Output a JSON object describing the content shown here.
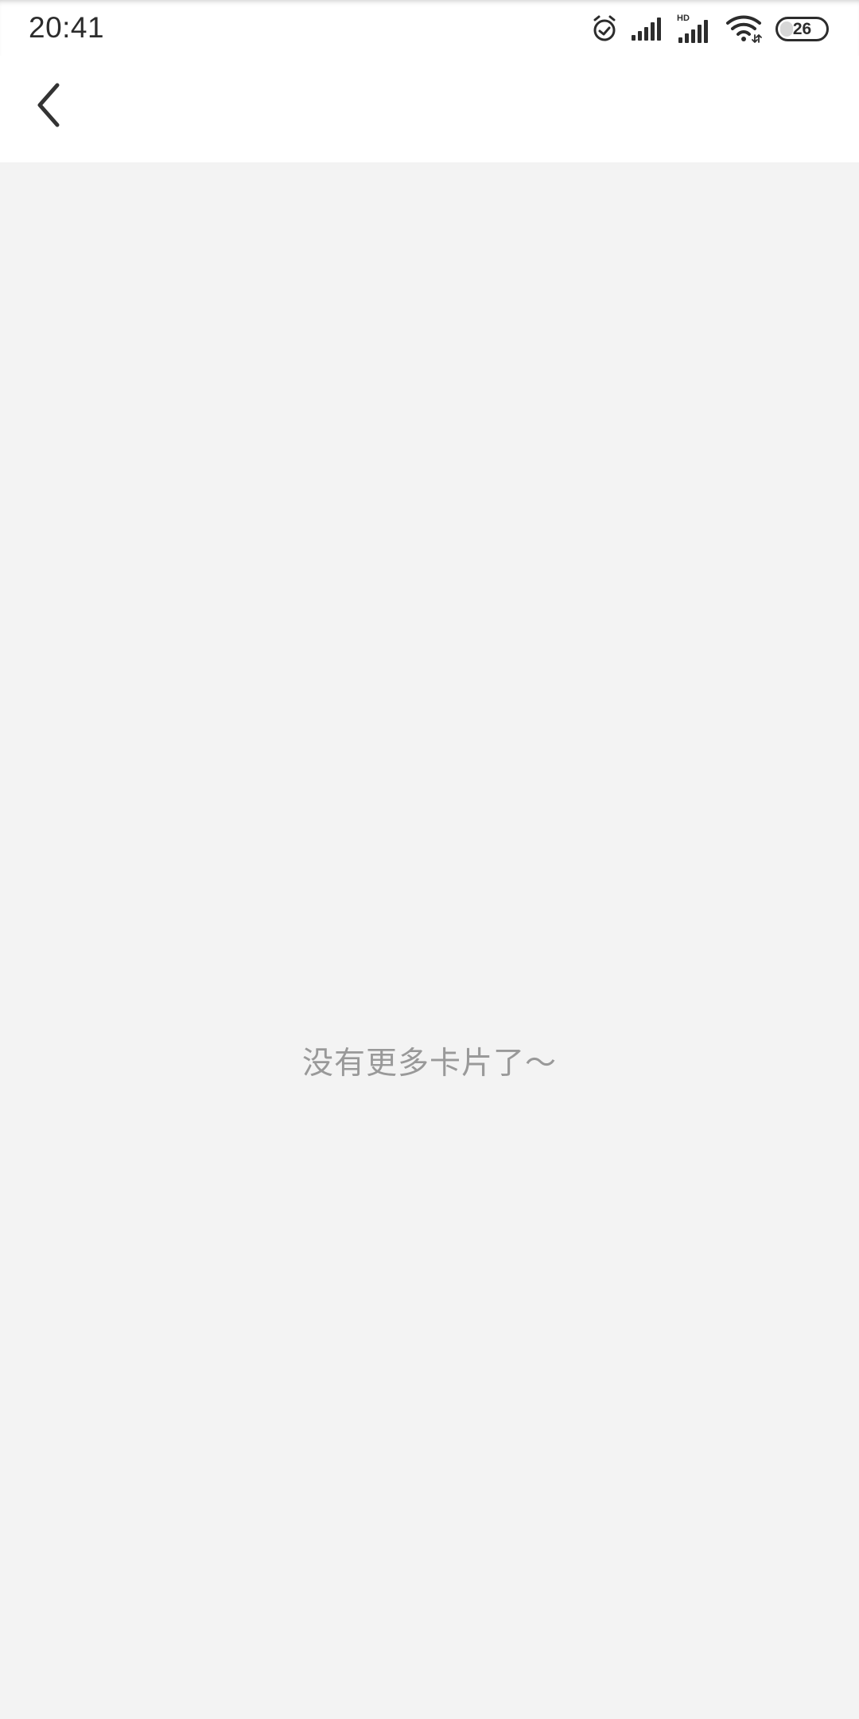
{
  "status_bar": {
    "time": "20:41",
    "network_label": "HD",
    "battery_level": "26",
    "icons": [
      "alarm-icon",
      "signal-icon",
      "hd-signal-icon",
      "wifi-icon",
      "battery-icon"
    ]
  },
  "navigation": {
    "back_icon": "chevron-left-icon"
  },
  "main": {
    "empty_message": "没有更多卡片了～"
  },
  "colors": {
    "background": "#f3f3f3",
    "header": "#ffffff",
    "primary_text": "#2c2c2c",
    "muted_text": "#999999"
  }
}
